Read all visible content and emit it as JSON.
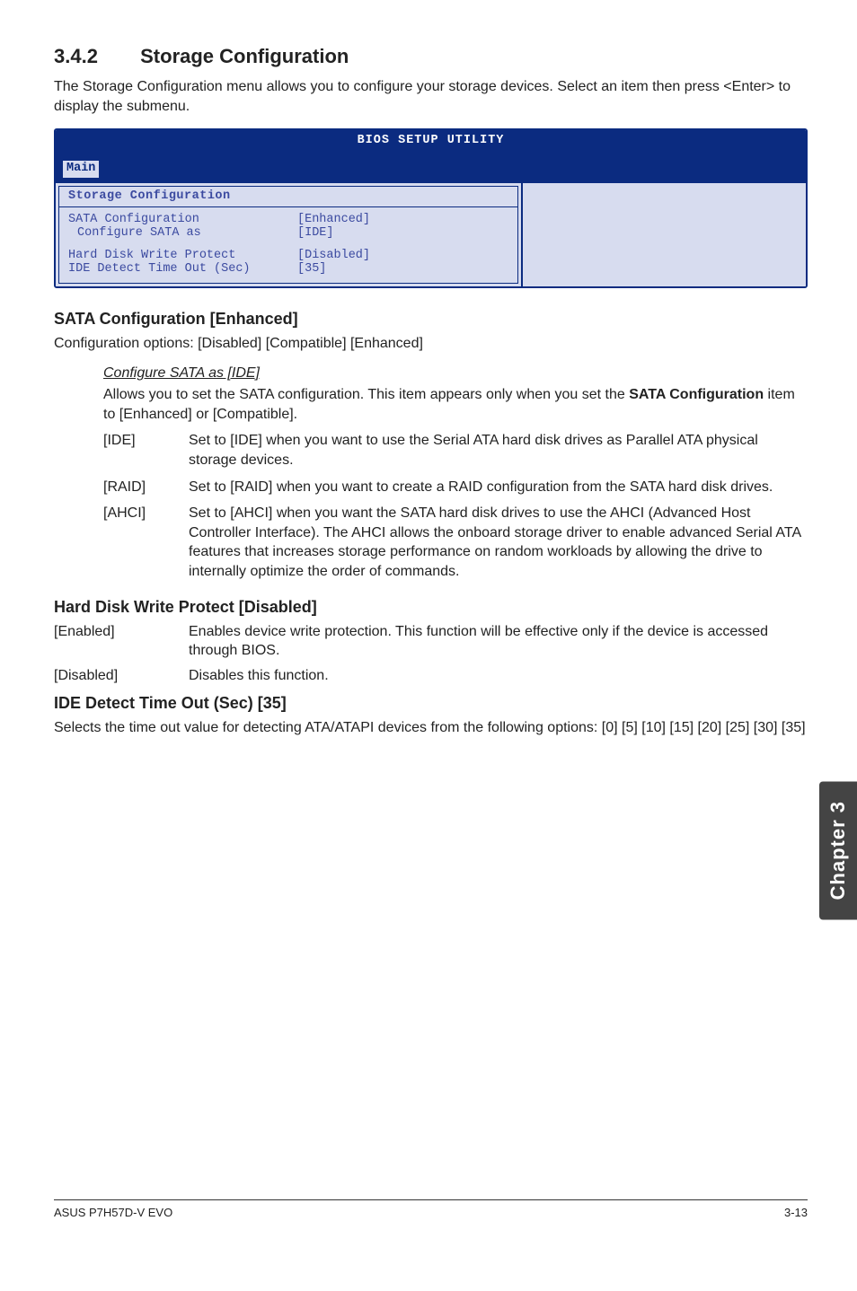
{
  "section": {
    "number": "3.4.2",
    "title": "Storage Configuration"
  },
  "intro": "The Storage Configuration menu allows you to configure your storage devices. Select an item then press <Enter> to display the submenu.",
  "bios": {
    "utility_title": "BIOS SETUP UTILITY",
    "tab": "Main",
    "panel_title": "Storage Configuration",
    "rows": {
      "sata_conf_k": "SATA Configuration",
      "sata_conf_v": "[Enhanced]",
      "conf_as_k": "Configure SATA as",
      "conf_as_v": "[IDE]",
      "hdwp_k": "Hard Disk Write Protect",
      "hdwp_v": "[Disabled]",
      "idet_k": "IDE Detect Time Out (Sec)",
      "idet_v": "[35]"
    }
  },
  "sata_conf": {
    "heading": "SATA Configuration [Enhanced]",
    "line": "Configuration options: [Disabled] [Compatible] [Enhanced]",
    "sub_heading": "Configure SATA as [IDE]",
    "sub_para_a": "Allows you to set the SATA configuration. This item appears only when you set the ",
    "sub_para_b_bold": "SATA Configuration",
    "sub_para_c": " item to [Enhanced] or [Compatible].",
    "opts": {
      "ide_k": "[IDE]",
      "ide_v": "Set to [IDE] when you want to use the Serial ATA hard disk drives as Parallel ATA physical storage devices.",
      "raid_k": "[RAID]",
      "raid_v": "Set to [RAID] when you want to create a RAID configuration from the SATA hard disk drives.",
      "ahci_k": "[AHCI]",
      "ahci_v": "Set to [AHCI] when you want the SATA hard disk drives to use the AHCI (Advanced Host Controller Interface). The AHCI allows the onboard storage driver to enable advanced Serial ATA features that increases storage performance on random workloads by allowing the drive to internally optimize the order of commands."
    }
  },
  "hdwp": {
    "heading": "Hard Disk Write Protect [Disabled]",
    "en_k": "[Enabled]",
    "en_v": "Enables device write protection. This function will be effective only if the device is accessed through BIOS.",
    "dis_k": "[Disabled]",
    "dis_v": "Disables this function."
  },
  "ide_time": {
    "heading": "IDE Detect Time Out (Sec) [35]",
    "body": "Selects the time out value for detecting ATA/ATAPI devices from the following options: [0] [5] [10] [15] [20] [25] [30] [35]"
  },
  "side_tab": "Chapter 3",
  "footer_left": "ASUS P7H57D-V EVO",
  "footer_right": "3-13"
}
